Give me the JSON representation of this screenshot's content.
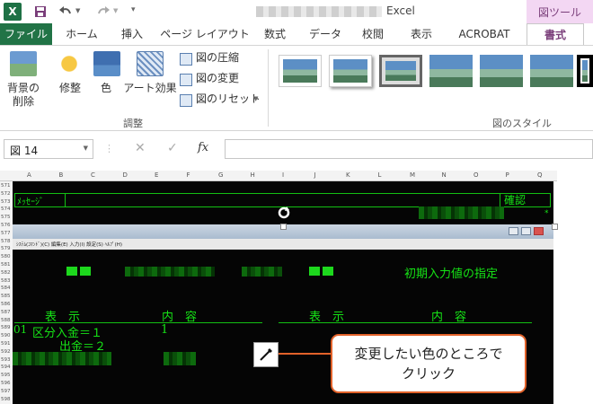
{
  "window": {
    "title": "Excel",
    "context_tab_group": "図ツール"
  },
  "tabs": [
    "ファイル",
    "ホーム",
    "挿入",
    "ページ レイアウト",
    "数式",
    "データ",
    "校閲",
    "表示",
    "ACROBAT",
    "書式"
  ],
  "ribbon": {
    "remove_bg_label_1": "背景の",
    "remove_bg_label_2": "削除",
    "corrections_label": "修整",
    "color_label": "色",
    "artistic_label": "アート効果",
    "compress_label": "図の圧縮",
    "change_label": "図の変更",
    "reset_label": "図のリセット",
    "adjust_group": "調整",
    "styles_group": "図のスタイル"
  },
  "formula_bar": {
    "name_box": "図 14",
    "fx": "fx",
    "formula": ""
  },
  "columns": [
    "A",
    "B",
    "C",
    "D",
    "E",
    "F",
    "G",
    "H",
    "I",
    "J",
    "K",
    "L",
    "M",
    "N",
    "O",
    "P",
    "Q"
  ],
  "rows": [
    "571",
    "572",
    "573",
    "574",
    "575",
    "576",
    "577",
    "578",
    "579",
    "580",
    "581",
    "582",
    "583",
    "584",
    "585",
    "586",
    "587",
    "588",
    "589",
    "590",
    "591",
    "592",
    "593",
    "594",
    "595",
    "596",
    "597",
    "598"
  ],
  "screen": {
    "message": "ﾒｯｾｰｼﾞ",
    "confirm": "確認",
    "star": "*",
    "menu_items": "ｼｽﾃﾑ(ｺﾏﾝﾄﾞ)(C)  編集(E)  入力(I)  設定(S)  ﾍﾙﾌﾟ(H)",
    "heading": "初期入力値の指定",
    "col_display": "表　示",
    "col_content": "内　容",
    "col_display2": "表　示",
    "col_content2": "内　容",
    "row1_num": "01",
    "row1_text": "区分入金＝１",
    "row1_val": "1",
    "row2_text": "出金＝２"
  },
  "callout": {
    "line1": "変更したい色のところで",
    "line2": "クリック"
  },
  "colors": {
    "excel_green": "#217346",
    "screen_green": "#16e316",
    "callout_orange": "#e2622a",
    "format_tab": "#7a3e7a"
  }
}
